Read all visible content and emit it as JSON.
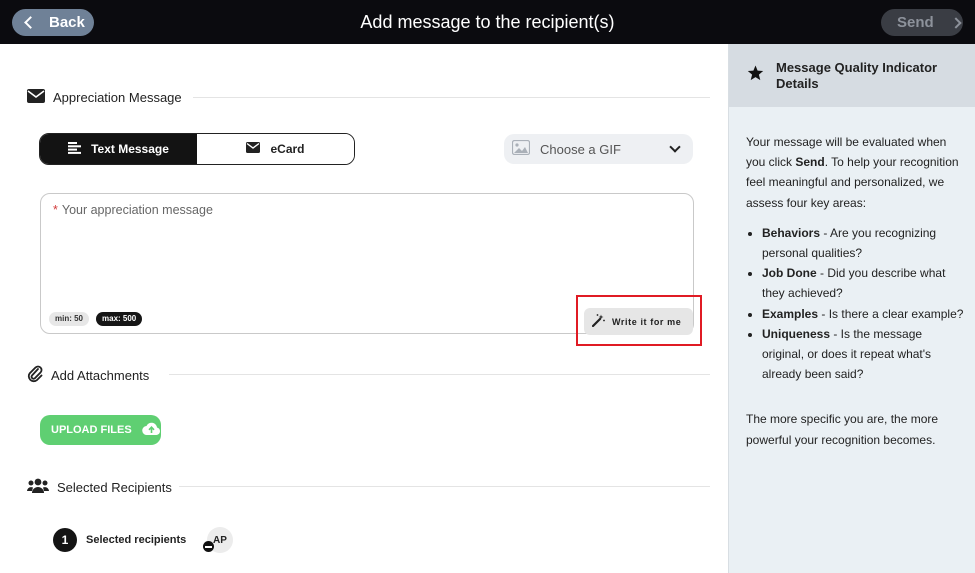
{
  "header": {
    "back_label": "Back",
    "title": "Add message to the recipient(s)",
    "send_label": "Send"
  },
  "message_section": {
    "heading": "Appreciation Message",
    "tabs": [
      {
        "label": "Text Message",
        "icon": "text-lines-icon",
        "active": true
      },
      {
        "label": "eCard",
        "icon": "envelope-icon",
        "active": false
      }
    ],
    "gif_select": {
      "label": "Choose a GIF",
      "icon": "image-icon"
    },
    "input": {
      "placeholder": "Your appreciation message",
      "required_marker": "*",
      "min_label": "min: 50",
      "max_label": "max: 500"
    },
    "write_button_label": "Write it for me"
  },
  "attachments": {
    "heading": "Add Attachments",
    "upload_label": "UPLOAD FILES"
  },
  "recipients": {
    "heading": "Selected Recipients",
    "count": "1",
    "count_label": "Selected recipients",
    "avatar_initials": "AP"
  },
  "quality_panel": {
    "title": "Message Quality Indicator Details",
    "intro_before": "Your message will be evaluated when you click ",
    "intro_bold": "Send",
    "intro_after": ". To help your recognition feel meaningful and personalized, we assess four key areas:",
    "criteria": [
      {
        "term": "Behaviors",
        "desc": " - Are you recognizing personal qualities?"
      },
      {
        "term": "Job Done",
        "desc": " - Did you describe what they achieved?"
      },
      {
        "term": "Examples",
        "desc": " - Is there a clear example?"
      },
      {
        "term": "Uniqueness",
        "desc": " - Is the message original, or does it repeat what's already been said?"
      }
    ],
    "outro": "The more specific you are, the more powerful your recognition becomes."
  },
  "colors": {
    "topbar": "#0b0b0f",
    "back_button": "#6f8197",
    "upload_button": "#5fcf72",
    "highlight_box": "#e01b24",
    "panel_bg": "#eaf0f4"
  }
}
